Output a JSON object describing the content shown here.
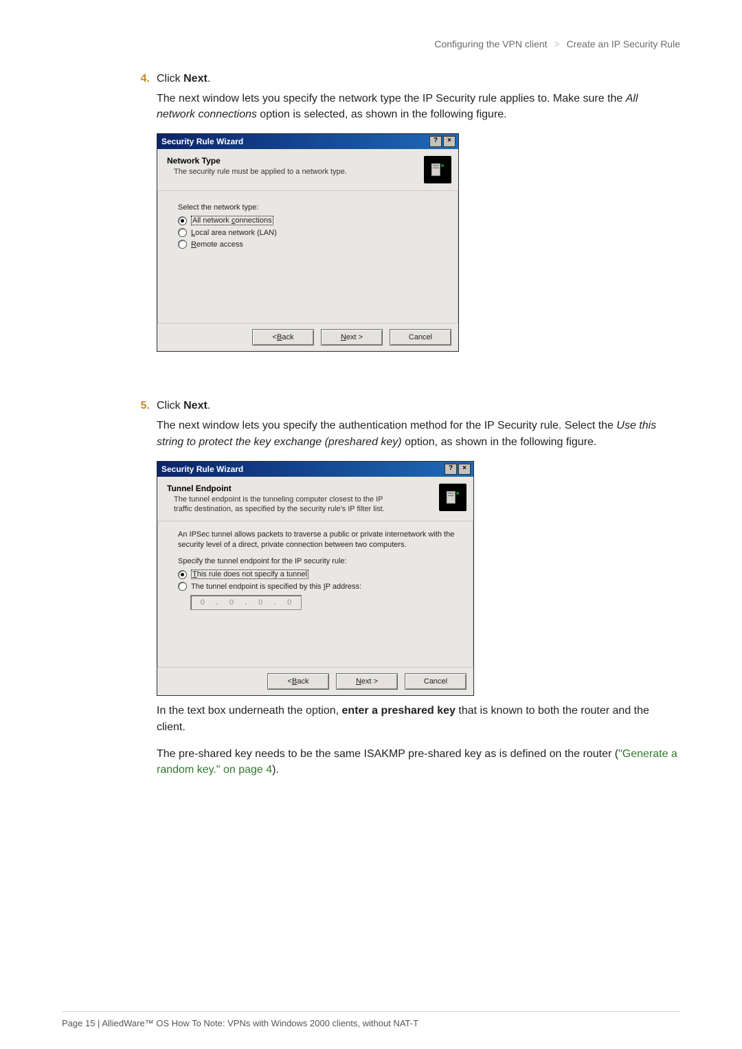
{
  "breadcrumb": {
    "left": "Configuring the VPN client",
    "sep": ">",
    "right": "Create an IP Security Rule"
  },
  "step4": {
    "num": "4.",
    "prefix": "Click ",
    "bold": "Next",
    "suffix": "."
  },
  "para4a": {
    "p1": "The next window lets you specify the network type the IP Security rule applies to. Make sure the ",
    "italic": "All network connections",
    "p2": " option is selected, as shown in the following figure."
  },
  "dlg1": {
    "title": "Security Rule Wizard",
    "help": "?",
    "close": "×",
    "head_title": "Network Type",
    "head_sub": "The security rule must be applied to a network type.",
    "body_label": "Select the network type:",
    "opt1_pre": "All network ",
    "opt1_ul": "c",
    "opt1_post": "onnections",
    "opt2_ul": "L",
    "opt2_post": "ocal area network (LAN)",
    "opt3_ul": "R",
    "opt3_post": "emote access",
    "back_pre": "< ",
    "back_ul": "B",
    "back_post": "ack",
    "next_ul": "N",
    "next_post": "ext >",
    "cancel": "Cancel"
  },
  "step5": {
    "num": "5.",
    "prefix": "Click ",
    "bold": "Next",
    "suffix": "."
  },
  "para5a": {
    "p1": "The next window lets you specify the authentication method for the IP Security rule. Select the ",
    "italic": "Use this string to protect the key exchange (preshared key)",
    "p2": " option, as shown in the following figure."
  },
  "dlg2": {
    "title": "Security Rule Wizard",
    "help": "?",
    "close": "×",
    "head_title": "Tunnel Endpoint",
    "head_sub": "The tunnel endpoint is the tunneling computer closest to the IP traffic destination, as specified by the security rule's IP filter list.",
    "intro": "An IPSec tunnel allows packets to traverse a public or private internetwork with the security level of a direct, private connection between two computers.",
    "body_label": "Specify the tunnel endpoint for the IP security rule:",
    "opt1_ul": "T",
    "opt1_post": "his rule does not specify a tunnel",
    "opt2_pre": "The tunnel endpoint is specified by this ",
    "opt2_ul": "I",
    "opt2_post": "P address:",
    "ip0": "0",
    "ip1": "0",
    "ip2": "0",
    "ip3": "0",
    "back_pre": "< ",
    "back_ul": "B",
    "back_post": "ack",
    "next_ul": "N",
    "next_post": "ext >",
    "cancel": "Cancel"
  },
  "para_post1": {
    "p1": "In the text box underneath the option, ",
    "bold": "enter a preshared key",
    "p2": " that is known to both the router and the client."
  },
  "para_post2": {
    "p1": "The pre-shared key needs to be the same ISAKMP pre-shared key as is defined on the router (",
    "link": "\"Generate a random key.\" on page 4",
    "p2": ")."
  },
  "footer": "Page 15 | AlliedWare™ OS How To Note: VPNs with Windows 2000 clients, without NAT-T"
}
